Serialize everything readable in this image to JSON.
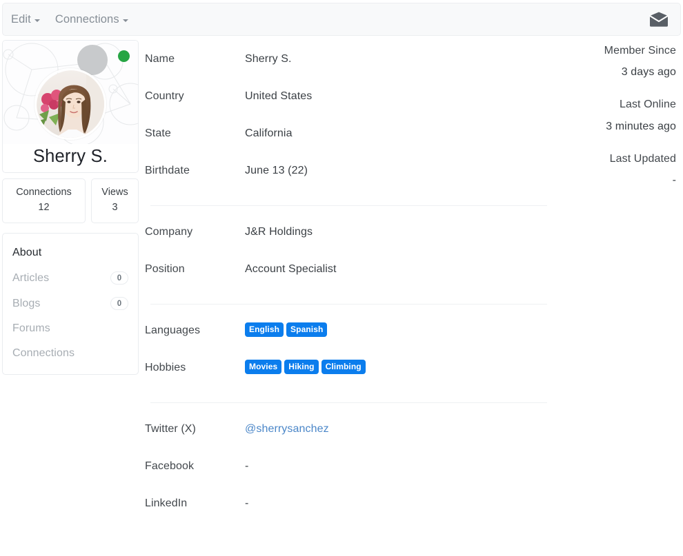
{
  "navbar": {
    "links": [
      {
        "label": "Edit",
        "icon": "chevron-down-icon"
      },
      {
        "label": "Connections",
        "icon": "chevron-down-icon"
      }
    ],
    "messages_icon": "envelope-icon"
  },
  "profile": {
    "name": "Sherry S.",
    "status": "online",
    "status_color": "#26a544",
    "avatar_alt": "profile-photo"
  },
  "stats": [
    {
      "label": "Connections",
      "value": "12"
    },
    {
      "label": "Views",
      "value": "3"
    }
  ],
  "menu": [
    {
      "label": "About",
      "badge": null,
      "active": true
    },
    {
      "label": "Articles",
      "badge": "0",
      "active": false
    },
    {
      "label": "Blogs",
      "badge": "0",
      "active": false
    },
    {
      "label": "Forums",
      "badge": null,
      "active": false
    },
    {
      "label": "Connections",
      "badge": null,
      "active": false
    }
  ],
  "about": {
    "group1": [
      {
        "label": "Name",
        "value": "Sherry S."
      },
      {
        "label": "Country",
        "value": "United States"
      },
      {
        "label": "State",
        "value": "California"
      },
      {
        "label": "Birthdate",
        "value": "June 13 (22)"
      }
    ],
    "group2": [
      {
        "label": "Company",
        "value": "J&R Holdings"
      },
      {
        "label": "Position",
        "value": "Account Specialist"
      }
    ],
    "group3": [
      {
        "label": "Languages",
        "badges": [
          "English",
          "Spanish"
        ]
      },
      {
        "label": "Hobbies",
        "badges": [
          "Movies",
          "Hiking",
          "Climbing"
        ]
      }
    ],
    "group4": [
      {
        "label": "Twitter (X)",
        "value": "@sherrysanchez",
        "is_link": true
      },
      {
        "label": "Facebook",
        "value": "-",
        "is_link": false
      },
      {
        "label": "LinkedIn",
        "value": "-",
        "is_link": false
      }
    ]
  },
  "meta": [
    {
      "label": "Member Since",
      "value": "3 days ago"
    },
    {
      "label": "Last Online",
      "value": "3 minutes ago"
    },
    {
      "label": "Last Updated",
      "value": "-"
    }
  ],
  "colors": {
    "badge_blue": "#0b7ded",
    "link_blue": "#4a86c8",
    "online_green": "#26a544",
    "navbar_bg": "#f8f9fa"
  }
}
